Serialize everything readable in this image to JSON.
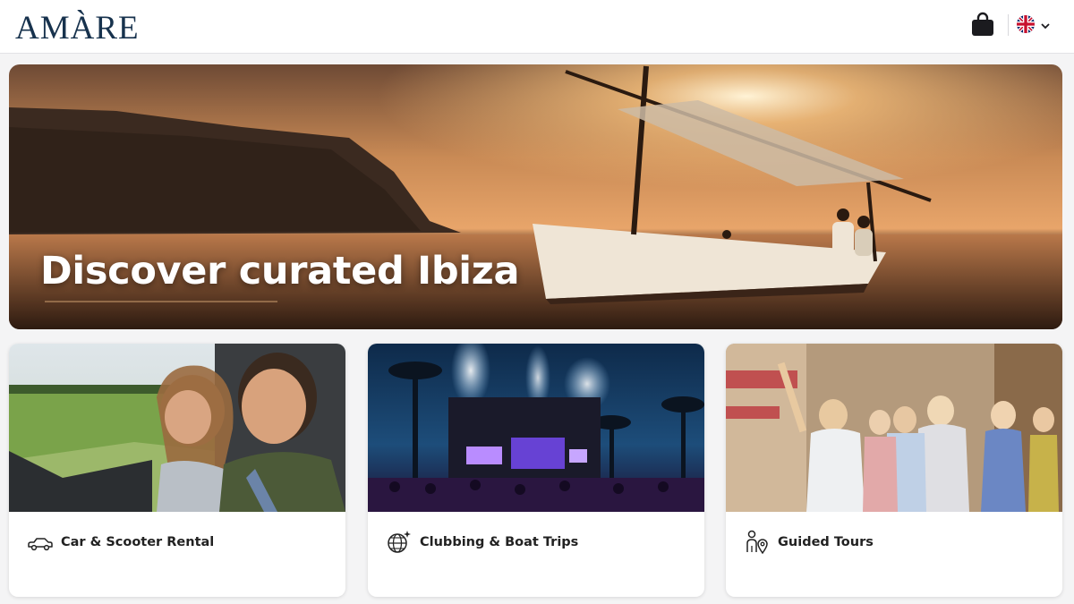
{
  "header": {
    "logo": "AMÀRE",
    "cart_icon": "shopping-bag-icon",
    "language_flag": "uk-flag-icon",
    "language_chevron": "chevron-down-icon"
  },
  "hero": {
    "title": "Discover curated Ibiza"
  },
  "categories": [
    {
      "label": "Car & Scooter Rental",
      "icon": "car-icon"
    },
    {
      "label": "Clubbing & Boat Trips",
      "icon": "disco-ball-icon"
    },
    {
      "label": "Guided Tours",
      "icon": "person-location-icon"
    }
  ],
  "colors": {
    "brand": "#17324d",
    "background": "#f4f4f5"
  }
}
